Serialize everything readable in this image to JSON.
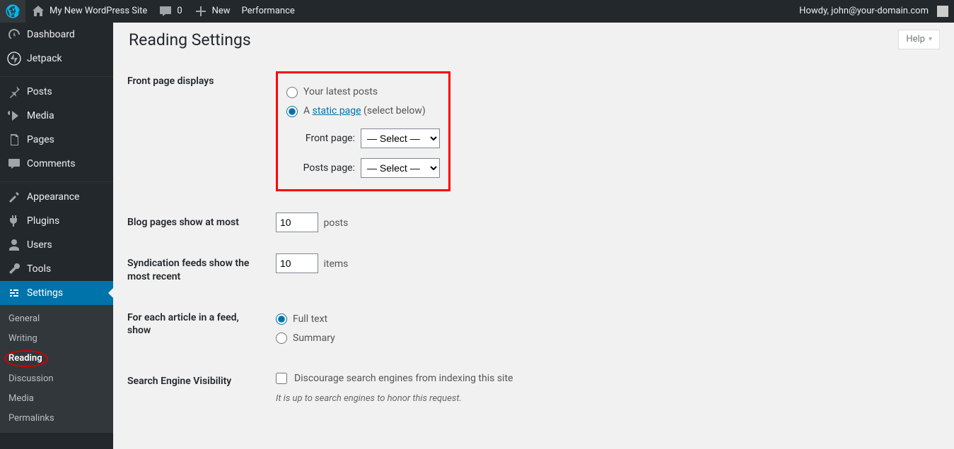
{
  "adminbar": {
    "site_name": "My New WordPress Site",
    "comments_count": "0",
    "new_label": "New",
    "performance_label": "Performance",
    "howdy": "Howdy, john@your-domain.com"
  },
  "sidebar": {
    "items": [
      {
        "label": "Dashboard",
        "icon": "dashboard"
      },
      {
        "label": "Jetpack",
        "icon": "jetpack"
      },
      {
        "label": "Posts",
        "icon": "posts"
      },
      {
        "label": "Media",
        "icon": "media"
      },
      {
        "label": "Pages",
        "icon": "pages"
      },
      {
        "label": "Comments",
        "icon": "comments"
      },
      {
        "label": "Appearance",
        "icon": "appearance"
      },
      {
        "label": "Plugins",
        "icon": "plugins"
      },
      {
        "label": "Users",
        "icon": "users"
      },
      {
        "label": "Tools",
        "icon": "tools"
      },
      {
        "label": "Settings",
        "icon": "settings"
      }
    ],
    "submenu": {
      "items": [
        {
          "label": "General"
        },
        {
          "label": "Writing"
        },
        {
          "label": "Reading"
        },
        {
          "label": "Discussion"
        },
        {
          "label": "Media"
        },
        {
          "label": "Permalinks"
        }
      ]
    }
  },
  "page": {
    "help": "Help",
    "title": "Reading Settings",
    "frontpage": {
      "label": "Front page displays",
      "opt_latest": "Your latest posts",
      "opt_static_prefix": "A ",
      "opt_static_link": "static page",
      "opt_static_suffix": " (select below)",
      "front_page_label": "Front page:",
      "posts_page_label": "Posts page:",
      "select_placeholder": "— Select —"
    },
    "blog_pages": {
      "label": "Blog pages show at most",
      "value": "10",
      "suffix": "posts"
    },
    "syndication": {
      "label": "Syndication feeds show the most recent",
      "value": "10",
      "suffix": "items"
    },
    "feed_article": {
      "label": "For each article in a feed, show",
      "opt_full": "Full text",
      "opt_summary": "Summary"
    },
    "search_visibility": {
      "label": "Search Engine Visibility",
      "checkbox": "Discourage search engines from indexing this site",
      "desc": "It is up to search engines to honor this request."
    }
  }
}
